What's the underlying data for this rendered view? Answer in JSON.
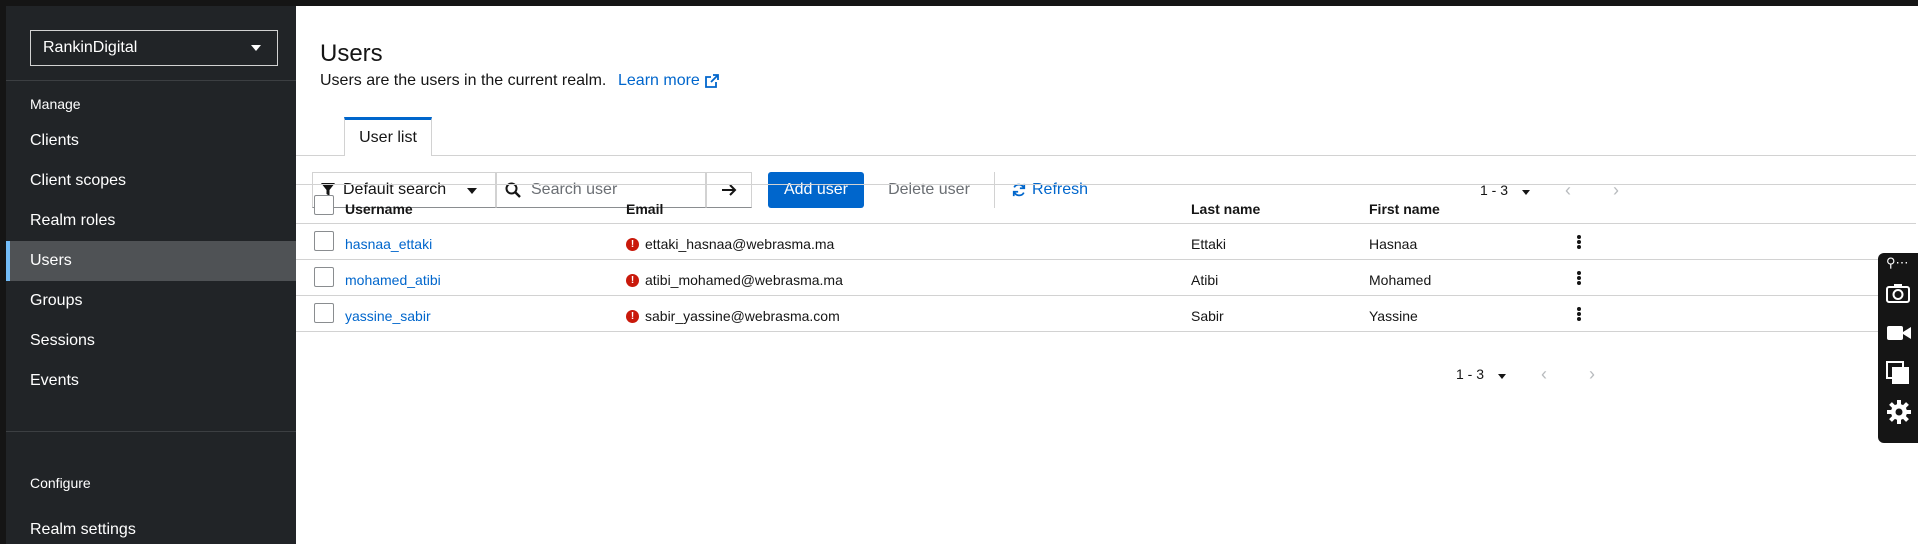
{
  "realm": {
    "selected": "RankinDigital"
  },
  "sidebar": {
    "manage_heading": "Manage",
    "configure_heading": "Configure",
    "items": [
      {
        "label": "Clients"
      },
      {
        "label": "Client scopes"
      },
      {
        "label": "Realm roles"
      },
      {
        "label": "Users",
        "active": true
      },
      {
        "label": "Groups"
      },
      {
        "label": "Sessions"
      },
      {
        "label": "Events"
      }
    ],
    "configure_items": [
      {
        "label": "Realm settings"
      }
    ]
  },
  "page": {
    "title": "Users",
    "description": "Users are the users in the current realm.",
    "learn_more": "Learn more"
  },
  "tabs": [
    {
      "label": "User list",
      "active": true
    }
  ],
  "toolbar": {
    "filter_label": "Default search",
    "search_placeholder": "Search user",
    "add_user": "Add user",
    "delete_user": "Delete user",
    "refresh": "Refresh",
    "pagination": "1 - 3"
  },
  "table": {
    "columns": [
      "Username",
      "Email",
      "Last name",
      "First name"
    ],
    "rows": [
      {
        "username": "hasnaa_ettaki",
        "email": "ettaki_hasnaa@webrasma.ma",
        "last_name": "Ettaki",
        "first_name": "Hasnaa"
      },
      {
        "username": "mohamed_atibi",
        "email": "atibi_mohamed@webrasma.ma",
        "last_name": "Atibi",
        "first_name": "Mohamed"
      },
      {
        "username": "yassine_sabir",
        "email": "sabir_yassine@webrasma.com",
        "last_name": "Sabir",
        "first_name": "Yassine"
      }
    ]
  },
  "footer": {
    "pagination": "1 - 3"
  },
  "colors": {
    "primary": "#0066cc",
    "sidebar_bg": "#212427",
    "active_item_bg": "#4f5255",
    "error": "#c9190b"
  }
}
